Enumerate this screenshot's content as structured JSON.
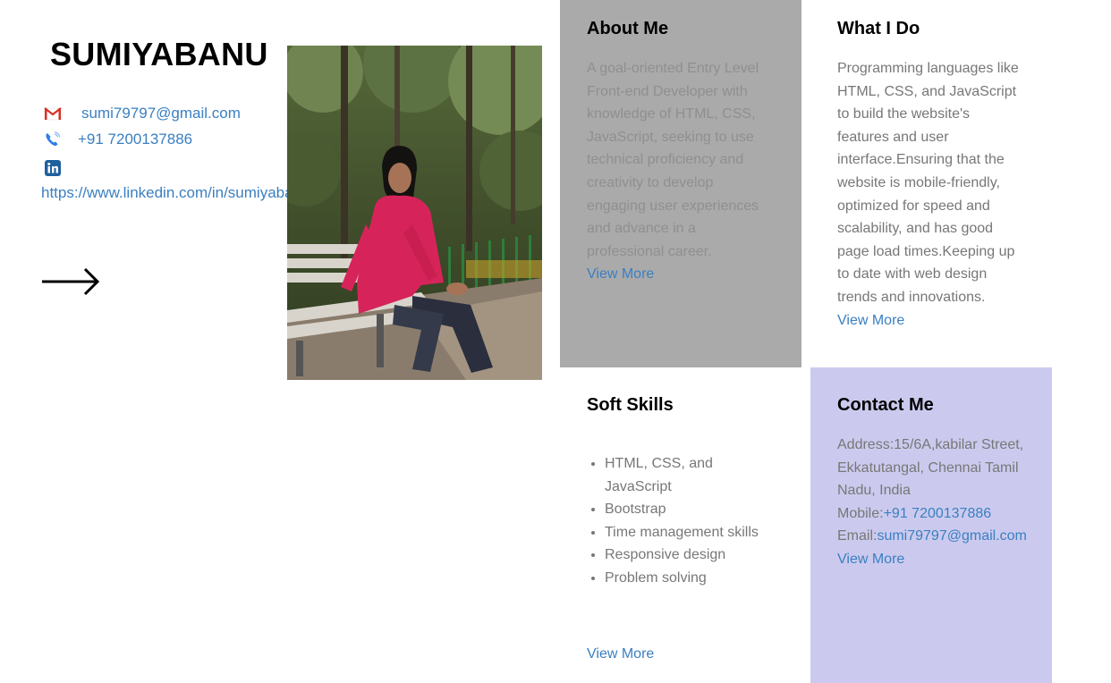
{
  "profile": {
    "name": "SUMIYABANU",
    "email": "sumi79797@gmail.com",
    "phone": "+91 7200137886",
    "linkedin": "https://www.linkedin.com/in/sumiyabanu"
  },
  "about": {
    "title": "About Me",
    "text": "A goal-oriented Entry Level Front-end Developer with knowledge of HTML, CSS, JavaScript, seeking to use technical proficiency and creativity to develop engaging user experiences and advance in a professional career.",
    "more": "View More"
  },
  "what": {
    "title": "What I Do",
    "text": "Programming languages like HTML, CSS, and JavaScript to build the website's features and user interface.Ensuring that the website is mobile-friendly, optimized for speed and scalability, and has good page load times.Keeping up to date with web design trends and innovations.",
    "more": "View More"
  },
  "skills": {
    "title": "Soft Skills",
    "items": [
      "HTML, CSS, and JavaScript",
      "Bootstrap",
      "Time management skills",
      "Responsive design",
      "Problem solving"
    ],
    "more": "View More"
  },
  "contact": {
    "title": "Contact Me",
    "address": "Address:15/6A,kabilar Street, Ekkatutangal, Chennai Tamil Nadu, India",
    "phone_label": "Mobile:",
    "phone": "+91 7200137886",
    "email_label": "Email:",
    "email": "sumi79797@gmail.com",
    "more": "View More"
  },
  "icons": {
    "email": "gmail-icon",
    "phone": "phone-icon",
    "linkedin": "linkedin-icon",
    "next": "arrow-right-icon"
  },
  "colors": {
    "link": "#3a7fc1",
    "about_bg": "#aaaaaa",
    "contact_bg": "#cbcaee"
  }
}
